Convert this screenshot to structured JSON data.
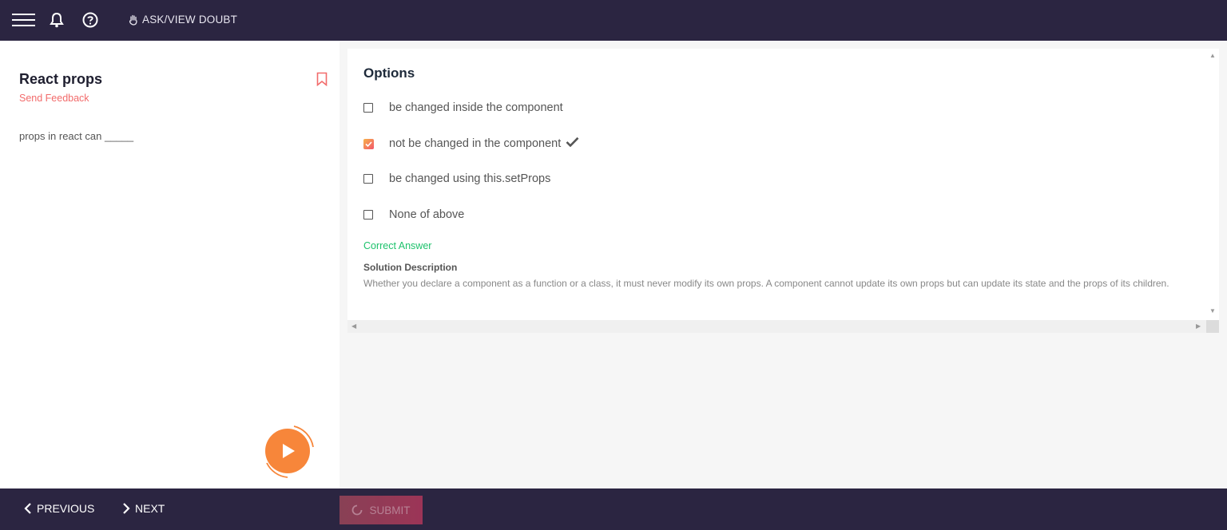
{
  "topbar": {
    "ask_label": "ASK/VIEW DOUBT"
  },
  "question": {
    "title": "React props",
    "feedback": "Send Feedback",
    "text": "props in react can _____"
  },
  "options": {
    "title": "Options",
    "items": [
      {
        "label": "be changed inside the component",
        "checked": false
      },
      {
        "label": "not be changed in the component",
        "checked": true
      },
      {
        "label": "be changed using this.setProps",
        "checked": false
      },
      {
        "label": "None of above",
        "checked": false
      }
    ],
    "correct_label": "Correct Answer",
    "solution_heading": "Solution Description",
    "solution_text": "Whether you declare a component as a function or a class, it must never modify its own props. A component cannot update its own props but can update its state and the props of its children."
  },
  "bottombar": {
    "previous_label": "PREVIOUS",
    "next_label": "NEXT",
    "submit_label": "SUBMIT"
  },
  "colors": {
    "bar_bg": "#2b2541",
    "accent_red": "#f26b6b",
    "correct_green": "#1ec26c",
    "play_orange": "#f7863a"
  },
  "icons": {
    "menu": "hamburger-icon",
    "bell": "bell-icon",
    "help": "question-circle-icon",
    "ask": "hand-icon",
    "bookmark": "bookmark-icon",
    "play": "play-icon",
    "check": "checkmark-icon",
    "prev": "chevron-left-icon",
    "next": "chevron-right-icon",
    "submit": "spinner-icon"
  }
}
